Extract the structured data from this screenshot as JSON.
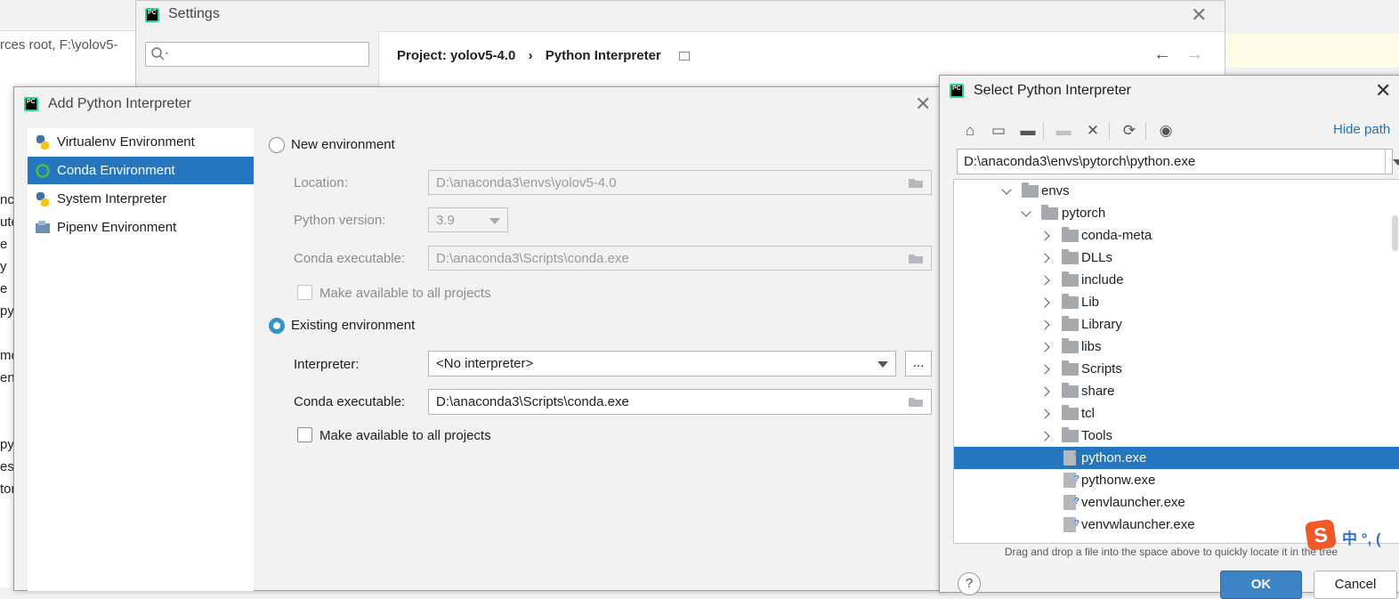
{
  "background": {
    "path_text": "rces root,  F:\\yolov5-",
    "fragments": [
      "nc",
      "ute",
      "e",
      "y",
      "e",
      "py",
      "mo",
      "en",
      "pyr",
      "es",
      "tor"
    ]
  },
  "settings": {
    "title": "Settings",
    "search_placeholder": "",
    "breadcrumb_project": "Project: yolov5-4.0",
    "breadcrumb_sep": "›",
    "breadcrumb_page": "Python Interpreter"
  },
  "add_dialog": {
    "title": "Add Python Interpreter",
    "env_items": [
      {
        "label": "Virtualenv Environment",
        "icon": "python-icon"
      },
      {
        "label": "Conda Environment",
        "icon": "conda-icon",
        "selected": true
      },
      {
        "label": "System Interpreter",
        "icon": "python-icon"
      },
      {
        "label": "Pipenv Environment",
        "icon": "pipenv-icon"
      }
    ],
    "new_env": {
      "radio_label": "New environment",
      "location_label": "Location:",
      "location_value": "D:\\anaconda3\\envs\\yolov5-4.0",
      "python_version_label": "Python version:",
      "python_version_value": "3.9",
      "conda_exec_label": "Conda executable:",
      "conda_exec_value": "D:\\anaconda3\\Scripts\\conda.exe",
      "make_available_label": "Make available to all projects"
    },
    "existing_env": {
      "radio_label": "Existing environment",
      "interpreter_label": "Interpreter:",
      "interpreter_value": "<No interpreter>",
      "browse_label": "...",
      "conda_exec_label": "Conda executable:",
      "conda_exec_value": "D:\\anaconda3\\Scripts\\conda.exe",
      "make_available_label": "Make available to all projects"
    }
  },
  "select_dialog": {
    "title": "Select Python Interpreter",
    "hide_path_label": "Hide path",
    "path_value": "D:\\anaconda3\\envs\\pytorch\\python.exe",
    "tree": [
      {
        "label": "envs",
        "type": "folder",
        "expanded": true,
        "level": 0
      },
      {
        "label": "pytorch",
        "type": "folder",
        "expanded": true,
        "level": 1
      },
      {
        "label": "conda-meta",
        "type": "folder",
        "level": 2
      },
      {
        "label": "DLLs",
        "type": "folder",
        "level": 2
      },
      {
        "label": "include",
        "type": "folder",
        "level": 2
      },
      {
        "label": "Lib",
        "type": "folder",
        "level": 2
      },
      {
        "label": "Library",
        "type": "folder",
        "level": 2
      },
      {
        "label": "libs",
        "type": "folder",
        "level": 2
      },
      {
        "label": "Scripts",
        "type": "folder",
        "level": 2
      },
      {
        "label": "share",
        "type": "folder",
        "level": 2
      },
      {
        "label": "tcl",
        "type": "folder",
        "level": 2
      },
      {
        "label": "Tools",
        "type": "folder",
        "level": 2
      },
      {
        "label": "python.exe",
        "type": "file",
        "level": 2,
        "selected": true
      },
      {
        "label": "pythonw.exe",
        "type": "file",
        "level": 2
      },
      {
        "label": "venvlauncher.exe",
        "type": "file",
        "level": 2
      },
      {
        "label": "venvwlauncher.exe",
        "type": "file",
        "level": 2
      }
    ],
    "drag_hint": "Drag and drop a file into the space above to quickly locate it in the tree",
    "help_label": "?",
    "ok_label": "OK",
    "cancel_label": "Cancel"
  },
  "ime": {
    "logo": "S",
    "text": "中 °, ("
  },
  "colors": {
    "selection": "#2675bf",
    "link": "#2470b3",
    "radio_on": "#3592c4"
  }
}
